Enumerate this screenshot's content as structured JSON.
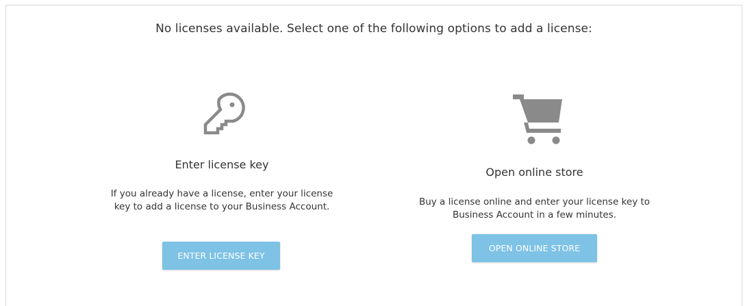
{
  "headline": "No licenses available. Select one of the following options to add a license:",
  "options": [
    {
      "icon": "key-icon",
      "title": "Enter license key",
      "description": "If you already have a license, enter your license key to add a license to your Business Account.",
      "button_label": "ENTER LICENSE KEY"
    },
    {
      "icon": "shopping-cart-icon",
      "title": "Open online store",
      "description": "Buy a license online and enter your license key to Business Account in a few minutes.",
      "button_label": "OPEN ONLINE STORE"
    }
  ],
  "colors": {
    "button_bg": "#7ec2e6",
    "icon_gray": "#8a8a8a",
    "text": "#333333",
    "border": "#d9d9d9"
  }
}
